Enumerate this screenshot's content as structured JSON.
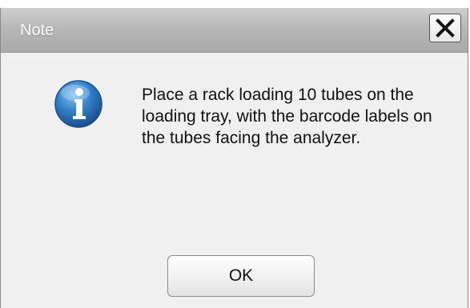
{
  "dialog": {
    "title": "Note",
    "close_icon": "close-icon",
    "info_icon": "info-icon",
    "message": "Place a rack loading 10 tubes on the loading tray, with the barcode labels on the tubes facing the analyzer.",
    "ok_label": "OK"
  },
  "colors": {
    "title_bar": "#b8b8b8",
    "body_background": "#f0f0f0",
    "info_icon_blue": "#2f7cc4"
  }
}
